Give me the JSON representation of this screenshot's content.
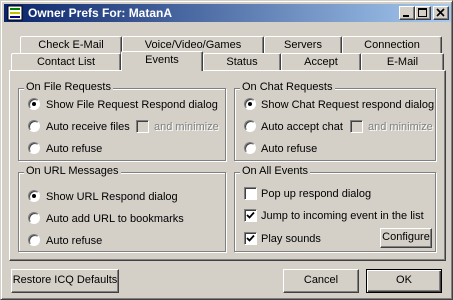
{
  "window": {
    "title": "Owner Prefs For: MatanA"
  },
  "tabs_back": [
    "Check E-Mail",
    "Voice/Video/Games",
    "Servers",
    "Connection"
  ],
  "tabs_front": [
    "Contact List",
    "Events",
    "Status",
    "Accept",
    "E-Mail"
  ],
  "active_tab": "Events",
  "file_requests": {
    "legend": "On File Requests",
    "options": [
      "Show File Request Respond dialog",
      "Auto receive files",
      "Auto refuse"
    ],
    "selected": "Show File Request Respond dialog",
    "and_minimize": {
      "label": "and minimize",
      "checked": false,
      "enabled": false
    }
  },
  "chat_requests": {
    "legend": "On Chat Requests",
    "options": [
      "Show Chat Request respond dialog",
      "Auto accept chat",
      "Auto refuse"
    ],
    "selected": "Show Chat Request respond dialog",
    "and_minimize": {
      "label": "and minimize",
      "checked": false,
      "enabled": false
    }
  },
  "url_messages": {
    "legend": "On URL Messages",
    "options": [
      "Show URL Respond dialog",
      "Auto add URL to bookmarks",
      "Auto refuse"
    ],
    "selected": "Show URL Respond dialog"
  },
  "all_events": {
    "legend": "On All Events",
    "popup": {
      "label": "Pop up respond dialog",
      "checked": false
    },
    "jump": {
      "label": "Jump to incoming event in the list",
      "checked": true
    },
    "sounds": {
      "label": "Play sounds",
      "checked": true
    },
    "configure_label": "Configure"
  },
  "footer": {
    "restore_label": "Restore ICQ Defaults",
    "cancel_label": "Cancel",
    "ok_label": "OK"
  }
}
